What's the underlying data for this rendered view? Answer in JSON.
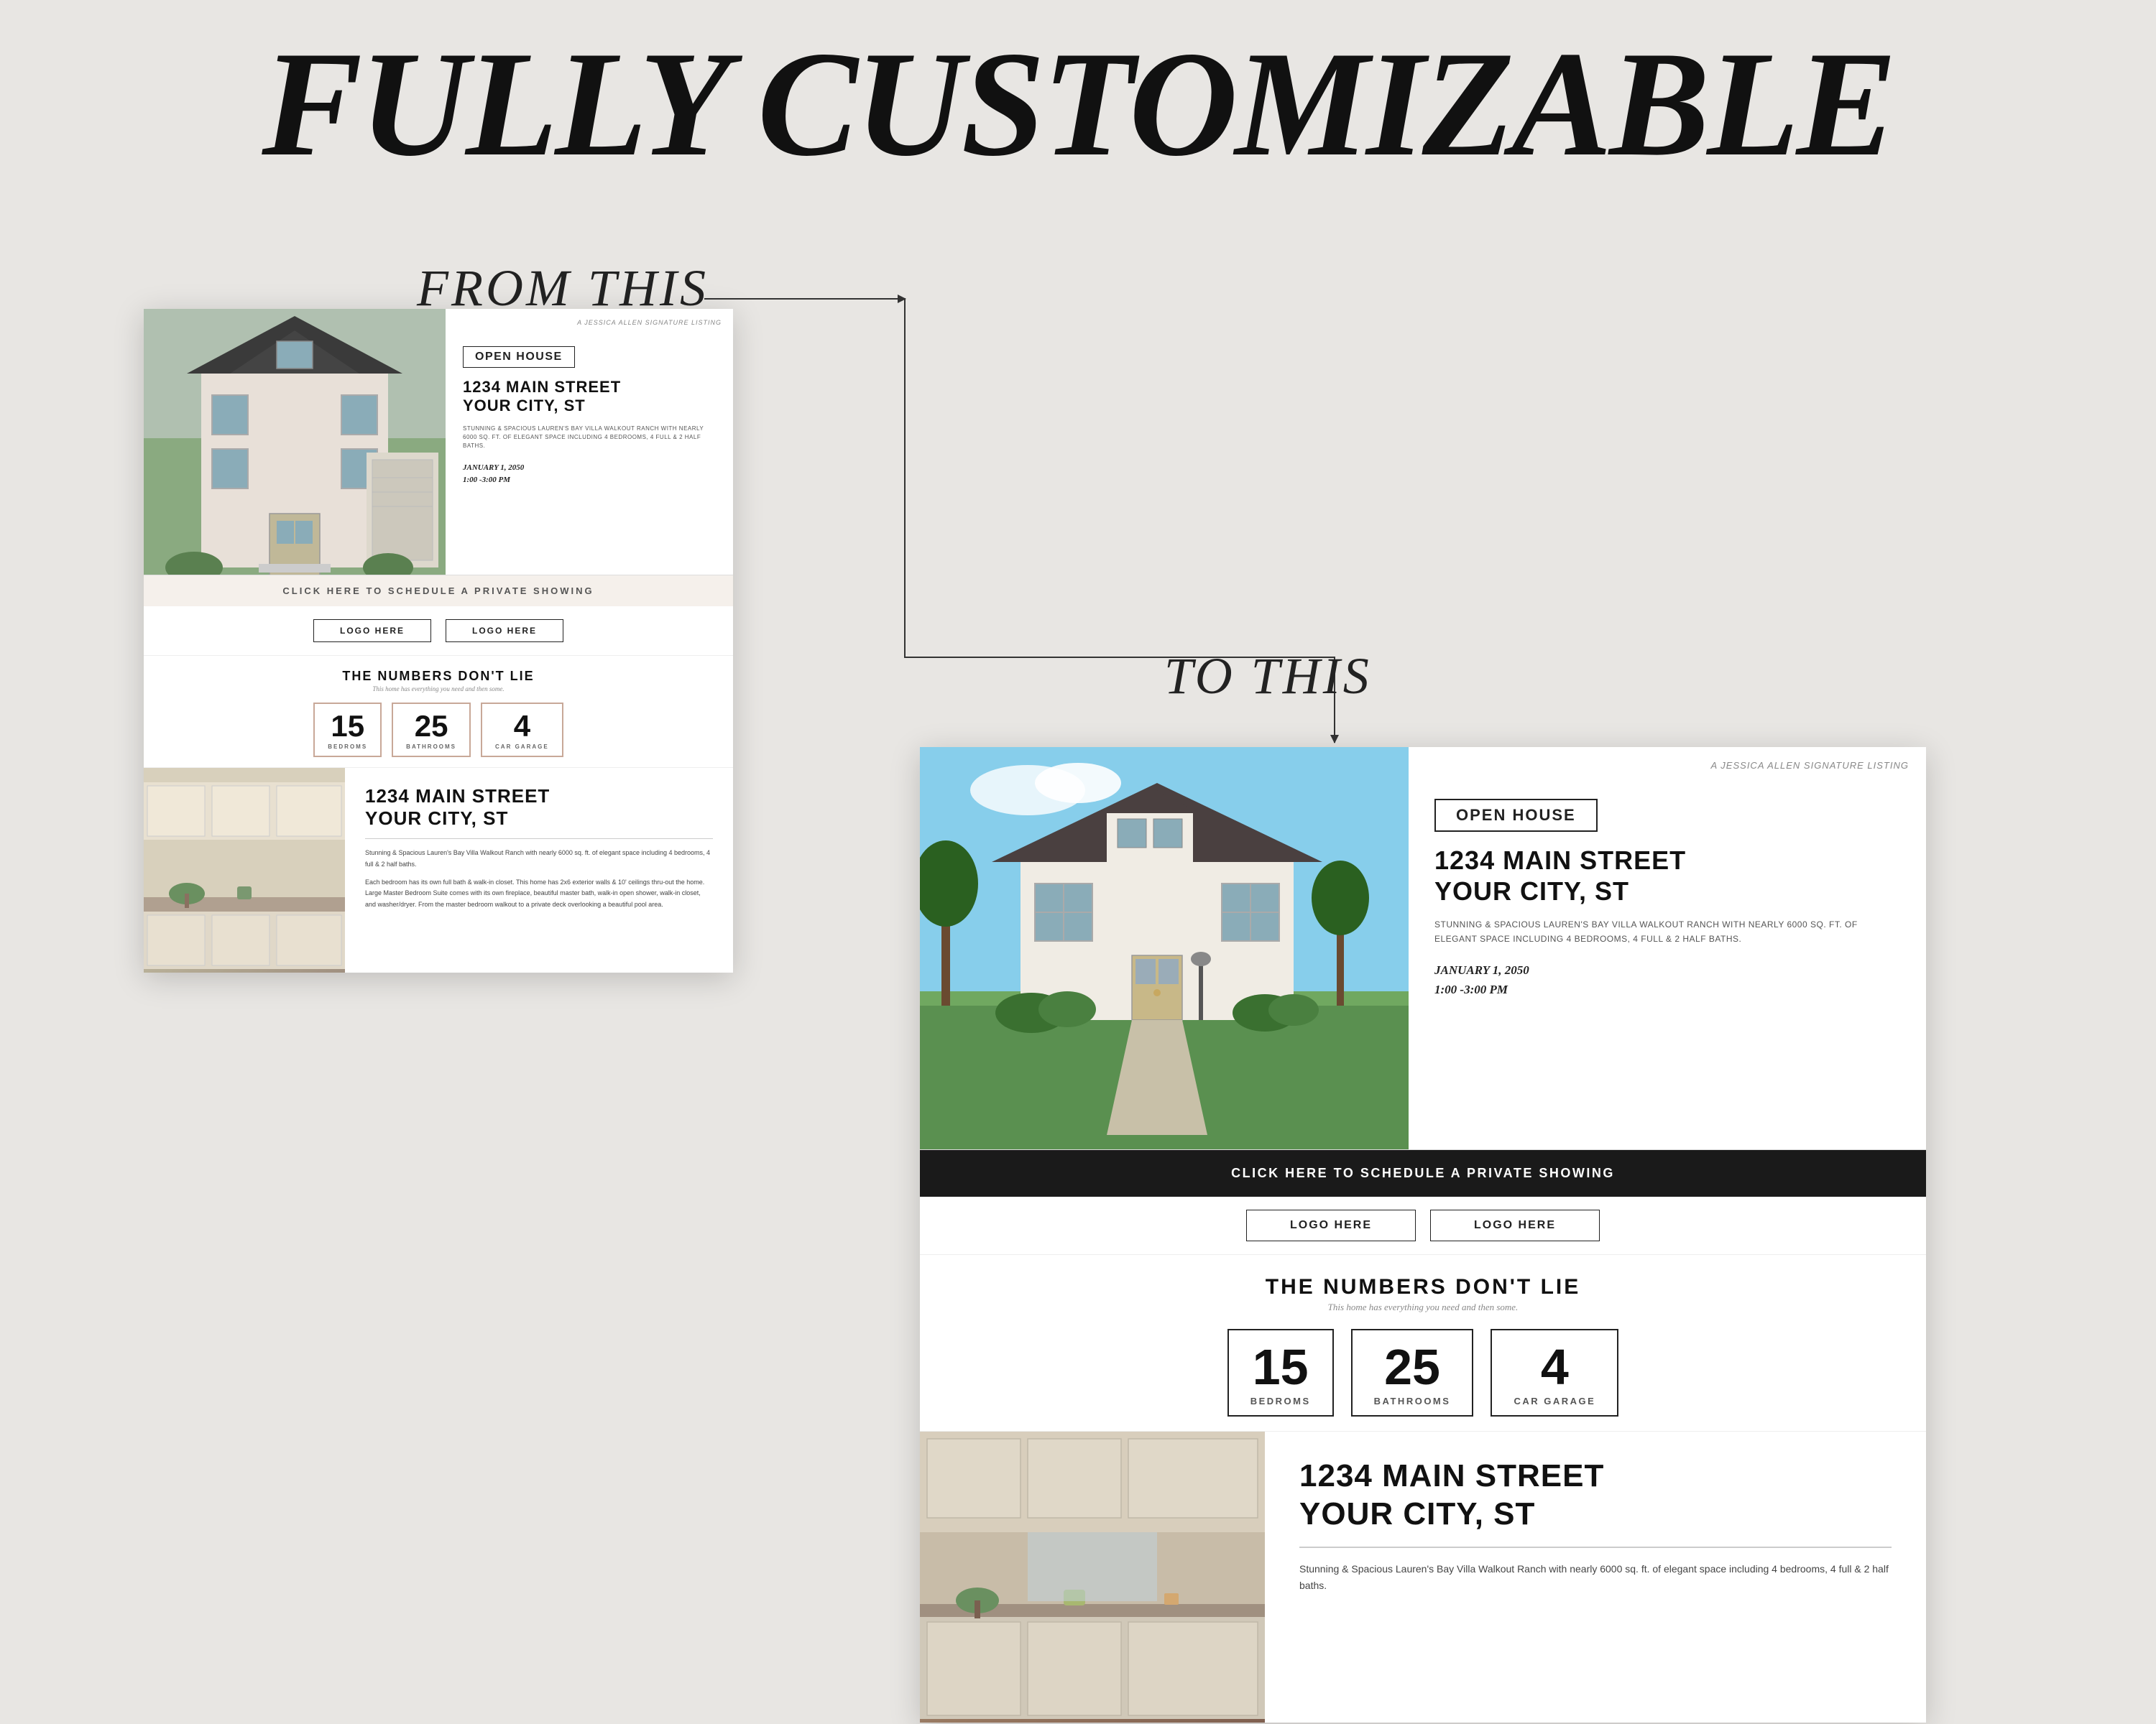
{
  "page": {
    "background_color": "#e8e6e3",
    "main_title": "FULLY CUSTOMIZABLE",
    "from_label": "FROM THIS",
    "to_label": "TO THIS"
  },
  "flyer_left": {
    "signature": "A JESSICA ALLEN SIGNATURE LISTING",
    "open_house": "OPEN HOUSE",
    "address_line1": "1234 MAIN STREET",
    "address_line2": "YOUR CITY, ST",
    "description": "STUNNING & SPACIOUS LAUREN'S BAY VILLA WALKOUT RANCH WITH NEARLY 6000 SQ. FT. OF ELEGANT SPACE INCLUDING 4 BEDROOMS, 4 FULL & 2 HALF BATHS.",
    "date": "JANUARY 1, 2050",
    "time": "1:00 -3:00 PM",
    "schedule_bar": "CLICK HERE TO SCHEDULE A PRIVATE SHOWING",
    "logo1": "LOGO HERE",
    "logo2": "LOGO HERE",
    "numbers_heading": "THE NUMBERS DON'T LIE",
    "numbers_sub": "This home has everything you need and then some.",
    "stat1_number": "15",
    "stat1_label": "BEDROMS",
    "stat2_number": "25",
    "stat2_label": "BATHROOMS",
    "stat3_number": "4",
    "stat3_label": "CAR GARAGE",
    "bottom_address_line1": "1234 MAIN STREET",
    "bottom_address_line2": "YOUR CITY, ST",
    "bottom_desc1": "Stunning & Spacious Lauren's Bay Villa Walkout Ranch with nearly 6000 sq. ft. of elegant space including 4 bedrooms, 4 full & 2 half baths.",
    "bottom_desc2": "Each bedroom has its own full bath & walk-in closet. This home has 2x6 exterior walls & 10' ceilings thru-out the home. Large Master Bedroom Suite comes with its own fireplace, beautiful master bath, walk-in open shower, walk-in closet, and washer/dryer. From the master bedroom walkout to a private deck overlooking a beautiful pool area."
  },
  "flyer_right": {
    "signature": "A JESSICA ALLEN SIGNATURE LISTING",
    "open_house": "OPEN HOUSE",
    "address_line1": "1234 MAIN STREET",
    "address_line2": "YOUR CITY, ST",
    "description": "STUNNING & SPACIOUS LAUREN'S BAY VILLA WALKOUT RANCH WITH NEARLY 6000 SQ. FT. OF ELEGANT SPACE INCLUDING 4 BEDROOMS, 4 FULL & 2 HALF BATHS.",
    "date": "JANUARY 1, 2050",
    "time": "1:00 -3:00 PM",
    "schedule_bar": "CLICK HERE TO SCHEDULE A PRIVATE SHOWING",
    "logo1": "LOGO HERE",
    "logo2": "LOGO HERE",
    "numbers_heading": "THE NUMBERS DON'T LIE",
    "numbers_sub": "This home has everything you need and then some.",
    "stat1_number": "15",
    "stat1_label": "BEDROMS",
    "stat2_number": "25",
    "stat2_label": "BATHROOMS",
    "stat3_number": "4",
    "stat3_label": "CAR GARAGE",
    "bottom_address_line1": "1234 MAIN STREET",
    "bottom_address_line2": "YOUR CITY, ST",
    "bottom_desc": "Stunning & Spacious Lauren's Bay Villa Walkout Ranch with nearly 6000 sq. ft. of elegant space including 4 bedrooms, 4 full & 2 half baths."
  }
}
